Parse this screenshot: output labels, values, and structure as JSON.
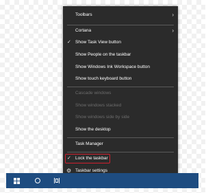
{
  "menu": {
    "items": [
      {
        "label": "Toolbars",
        "has_submenu": true,
        "enabled": true
      },
      {
        "label": "Cortana",
        "has_submenu": true,
        "enabled": true
      },
      {
        "label": "Show Task View button",
        "checked": true,
        "enabled": true
      },
      {
        "label": "Show People on the taskbar",
        "enabled": true
      },
      {
        "label": "Show Windows Ink Workspace button",
        "enabled": true
      },
      {
        "label": "Show touch keyboard button",
        "enabled": true
      },
      {
        "label": "Cascade windows",
        "enabled": false
      },
      {
        "label": "Show windows stacked",
        "enabled": false
      },
      {
        "label": "Show windows side by side",
        "enabled": false
      },
      {
        "label": "Show the desktop",
        "enabled": true
      },
      {
        "label": "Task Manager",
        "enabled": true
      },
      {
        "label": "Lock the taskbar",
        "checked": true,
        "enabled": true,
        "highlighted": true
      },
      {
        "label": "Taskbar settings",
        "icon": "gear-icon",
        "enabled": true
      }
    ],
    "submenu_glyph": "›",
    "check_glyph": "✓",
    "gear_glyph": "⚙"
  },
  "taskbar": {
    "icons": [
      "windows-start-icon",
      "cortana-icon",
      "task-view-icon"
    ]
  },
  "colors": {
    "menu_background": "#2b2b2b",
    "menu_text": "#ffffff",
    "disabled_text": "#6d6d6d",
    "separator": "#5a5a5a",
    "highlight_border": "#d0202e",
    "taskbar": "#1e4c80"
  }
}
